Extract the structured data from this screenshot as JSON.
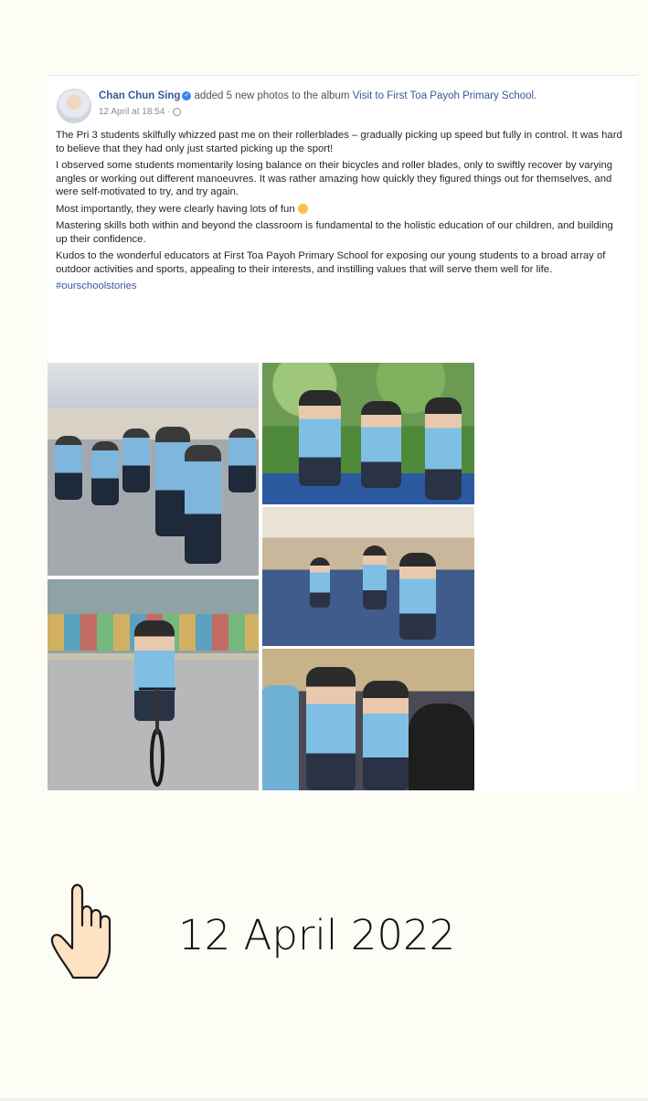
{
  "post": {
    "author": "Chan Chun Sing",
    "action_text": "added 5 new photos to the album",
    "album_title": "Visit to First Toa Payoh Primary School.",
    "timestamp": "12 April at 18:54 ·",
    "paragraphs": [
      "The Pri 3 students skilfully whizzed past me on their rollerblades – gradually picking up speed but fully in control. It was hard to believe that they had only just started picking up the sport!",
      "I observed some students momentarily losing balance on their bicycles and roller blades, only to swiftly recover by varying angles or working out different manoeuvres. It was rather amazing how quickly they figured things out for themselves, and were self-motivated to try, and try again.",
      "Most importantly, they were clearly having lots of fun",
      "Mastering skills both within and beyond the classroom is fundamental to the holistic education of our children, and building up their confidence.",
      "Kudos to the wonderful educators at First Toa Payoh Primary School for exposing our young students to a broad array of outdoor activities and sports, appealing to their interests, and instilling values that will serve them well for life."
    ],
    "hashtag": "#ourschoolstories",
    "photo_count": 5
  },
  "caption": {
    "date": "12 April 2022",
    "icon": "pointing-hand-icon"
  },
  "colors": {
    "background": "#fdfcf5",
    "link": "#385898",
    "verified": "#3b82f6",
    "hand_fill": "#fde3c4"
  }
}
